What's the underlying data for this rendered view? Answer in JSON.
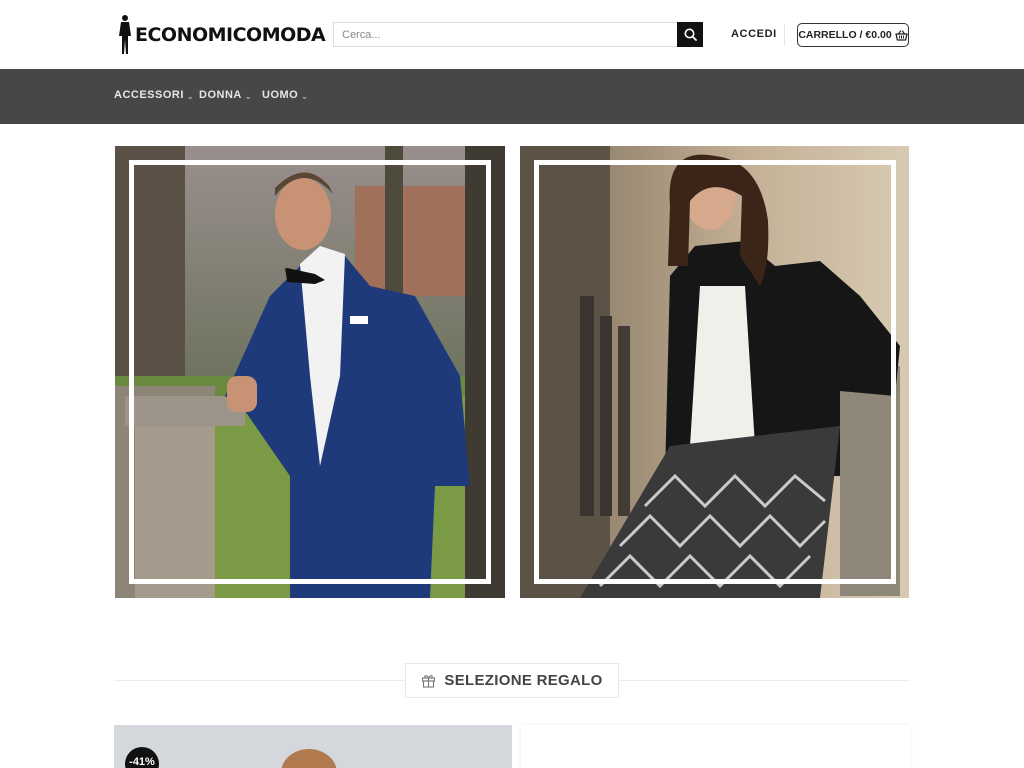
{
  "header": {
    "logo_text": "ECONOMICOMODA",
    "search_placeholder": "Cerca...",
    "login_label": "ACCEDI",
    "cart_label": "CARRELLO / €0.00"
  },
  "nav": {
    "items": [
      {
        "label": "ACCESSORI"
      },
      {
        "label": "DONNA"
      },
      {
        "label": "UOMO"
      }
    ]
  },
  "section": {
    "title": "SELEZIONE REGALO"
  },
  "products": [
    {
      "badge": "-41%"
    }
  ],
  "icons": {
    "search": "search-icon",
    "cart": "basket-icon",
    "gift": "gift-icon",
    "chevron": "chevron-down-icon"
  },
  "colors": {
    "nav_bg": "#474747",
    "accent": "#111111"
  }
}
